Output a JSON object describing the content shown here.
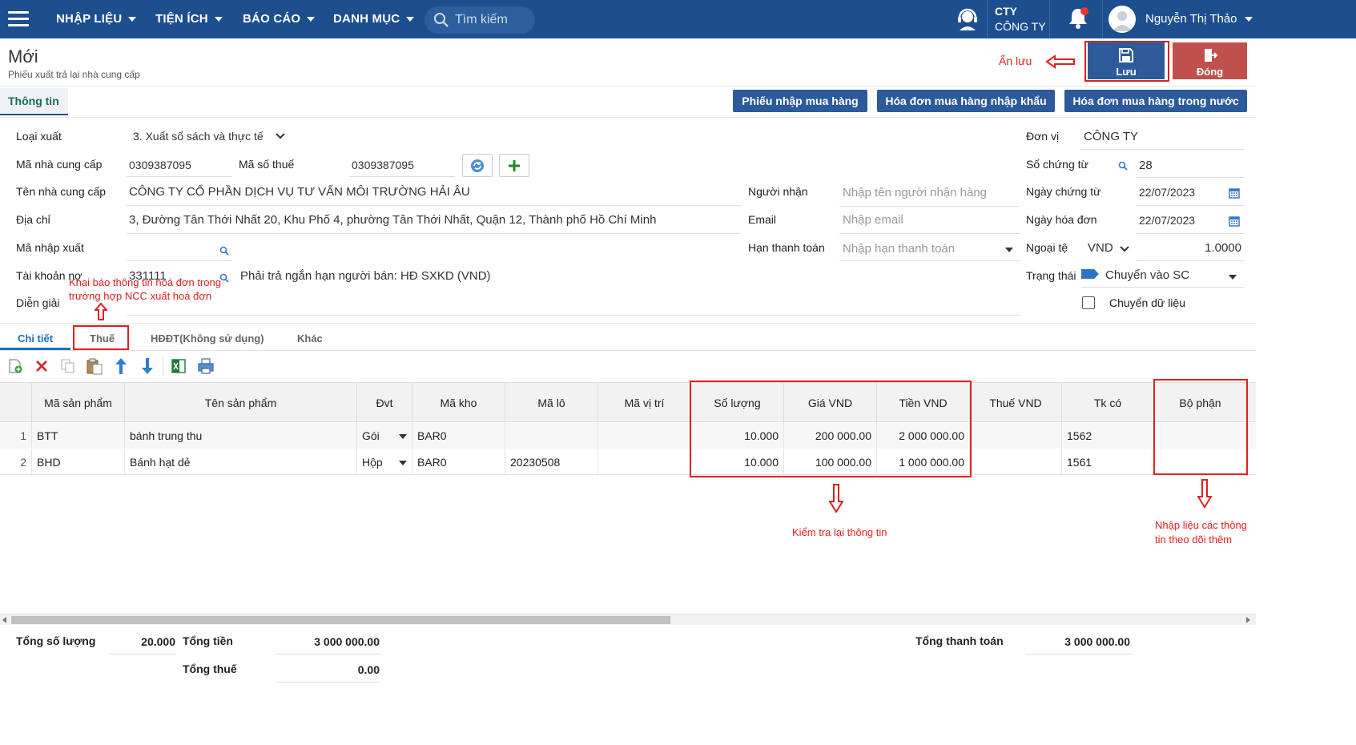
{
  "nav": {
    "menus": [
      "NHẬP LIỆU",
      "TIỆN ÍCH",
      "BÁO CÁO",
      "DANH MỤC"
    ],
    "search_placeholder": "Tìm kiếm",
    "company_short": "CTY",
    "company_name": "CÔNG TY",
    "user_name": "Nguyễn Thị Thảo"
  },
  "header": {
    "title": "Mới",
    "subtitle": "Phiếu xuất trả lại nhà cung cấp",
    "save_label": "Lưu",
    "close_label": "Đóng",
    "annotation_save": "Ấn lưu"
  },
  "tabs": {
    "info_label": "Thông tin",
    "buttons": [
      "Phiếu nhập mua hàng",
      "Hóa đơn mua hàng nhập khẩu",
      "Hóa đơn mua hàng trong nước"
    ]
  },
  "form": {
    "loai_xuat_label": "Loại xuất",
    "loai_xuat_value": "3. Xuất sổ sách và thực tế",
    "ma_ncc_label": "Mã nhà cung cấp",
    "ma_ncc_value": "0309387095",
    "ma_so_thue_label": "Mã số thuế",
    "ma_so_thue_value": "0309387095",
    "ten_ncc_label": "Tên nhà cung cấp",
    "ten_ncc_value": "CÔNG TY CỔ PHẦN DỊCH VỤ TƯ VẤN MÔI TRƯỜNG HẢI ÂU",
    "dia_chi_label": "Địa chỉ",
    "dia_chi_value": "3, Đường Tân Thới Nhất 20,  Khu Phố 4, phường Tân Thới Nhất, Quận 12, Thành phố Hồ Chí Minh",
    "ma_nhap_xuat_label": "Mã nhập xuất",
    "tai_khoan_no_label": "Tài khoản nợ",
    "tai_khoan_no_value": "331111",
    "tai_khoan_no_desc": "Phải trả ngắn hạn người bán: HĐ SXKD (VND)",
    "dien_giai_label": "Diễn giải",
    "nguoi_nhan_label": "Người nhận",
    "nguoi_nhan_placeholder": "Nhập tên người nhận hàng",
    "email_label": "Email",
    "email_placeholder": "Nhập email",
    "han_tt_label": "Hạn thanh toán",
    "han_tt_placeholder": "Nhập hạn thanh toán",
    "don_vi_label": "Đơn vị",
    "don_vi_value": "CÔNG TY",
    "so_ct_label": "Số chứng từ",
    "so_ct_value": "28",
    "ngay_ct_label": "Ngày chứng từ",
    "ngay_ct_value": "22/07/2023",
    "ngay_hd_label": "Ngày hóa đơn",
    "ngay_hd_value": "22/07/2023",
    "ngoai_te_label": "Ngoại tệ",
    "ngoai_te_value": "VND",
    "ty_gia_value": "1.0000",
    "trang_thai_label": "Trạng thái",
    "trang_thai_value": "Chuyển vào SC",
    "chuyen_du_lieu_label": "Chuyển dữ liệu"
  },
  "annotations": {
    "thue_note": "Khai báo thông tin hoá đơn trong trường hợp NCC xuất hoá đơn",
    "check_note": "Kiểm tra lại thông tin",
    "bo_phan_note": "Nhập liệu các thông tin theo dõi thêm"
  },
  "detail_tabs": [
    "Chi tiết",
    "Thuế",
    "HĐĐT(Không sử dụng)",
    "Khác"
  ],
  "grid": {
    "headers": [
      "Mã sản phẩm",
      "Tên sản phẩm",
      "Đvt",
      "Mã kho",
      "Mã lô",
      "Mã vị trí",
      "Số lượng",
      "Giá VND",
      "Tiền VND",
      "Thuế VND",
      "Tk có",
      "Bộ phận"
    ],
    "rows": [
      {
        "stt": "1",
        "ma_sp": "BTT",
        "ten_sp": "bánh trung thu",
        "dvt": "Gói",
        "ma_kho": "BAR0",
        "ma_lo": "",
        "ma_vt": "",
        "so_luong": "10.000",
        "gia": "200 000.00",
        "tien": "2 000 000.00",
        "thue": "",
        "tk_co": "1562",
        "bo_phan": ""
      },
      {
        "stt": "2",
        "ma_sp": "BHD",
        "ten_sp": "Bánh hạt dẻ",
        "dvt": "Hộp",
        "ma_kho": "BAR0",
        "ma_lo": "20230508",
        "ma_vt": "",
        "so_luong": "10.000",
        "gia": "100 000.00",
        "tien": "1 000 000.00",
        "thue": "",
        "tk_co": "1561",
        "bo_phan": ""
      }
    ]
  },
  "totals": {
    "tong_so_luong_label": "Tổng số lượng",
    "tong_so_luong": "20.000",
    "tong_tien_label": "Tổng tiền",
    "tong_tien": "3 000 000.00",
    "tong_thue_label": "Tổng thuế",
    "tong_thue": "0.00",
    "tong_tt_label": "Tổng thanh toán",
    "tong_tt": "3 000 000.00"
  },
  "colors": {
    "nav_bg": "#1d4f8f",
    "primary_button": "#2d5a9a",
    "close_button": "#c0504d",
    "annotation_red": "#e02020"
  }
}
